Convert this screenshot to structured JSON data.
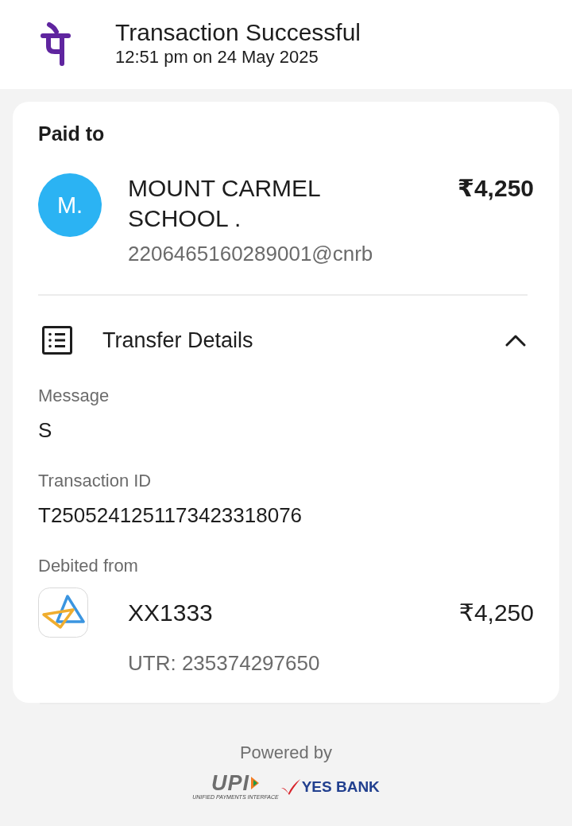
{
  "header": {
    "title": "Transaction Successful",
    "timestamp": "12:51 pm on 24 May 2025"
  },
  "paid_to": {
    "label": "Paid to",
    "avatar_initial": "M.",
    "name": "MOUNT CARMEL SCHOOL .",
    "upi_id": "2206465160289001@cnrb",
    "amount": "₹4,250"
  },
  "transfer_details": {
    "title": "Transfer Details",
    "expanded": true,
    "fields": [
      {
        "label": "Message",
        "value": "S"
      },
      {
        "label": "Transaction ID",
        "value": "T2505241251173423318076"
      }
    ],
    "debited_from": {
      "label": "Debited from",
      "account": "XX1333",
      "amount": "₹4,250",
      "utr": "UTR: 235374297650"
    }
  },
  "footer": {
    "powered_by": "Powered by",
    "upi_logo": "UPI",
    "upi_tagline": "UNIFIED PAYMENTS INTERFACE",
    "bank_logo": "YES BANK"
  }
}
